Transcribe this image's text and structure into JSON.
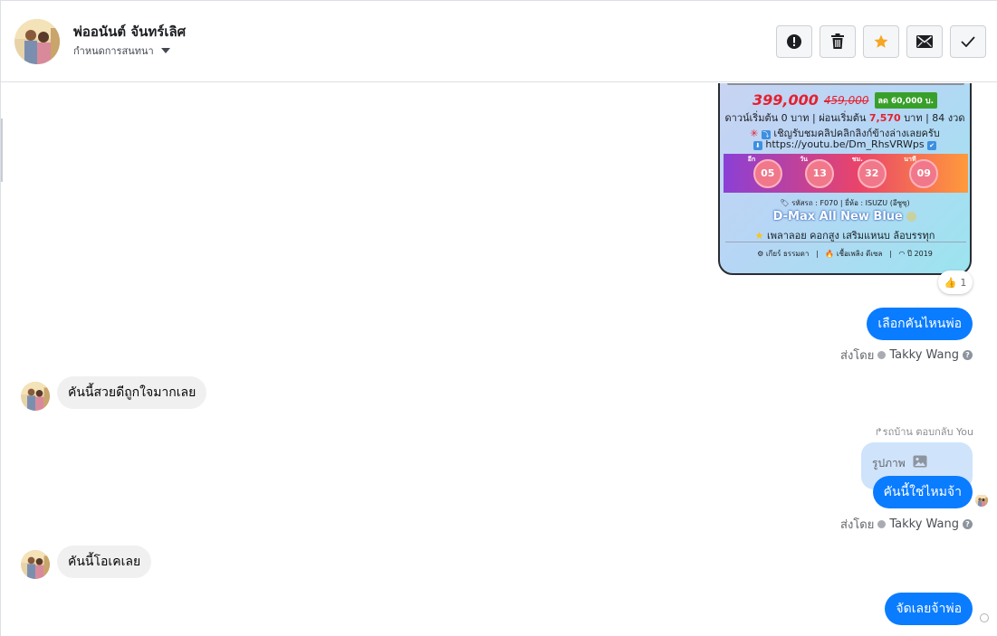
{
  "header": {
    "contact_name": "พ่ออนันต์ จันทร์เลิศ",
    "assign_label": "กำหนดการสนทนา",
    "actions": [
      {
        "name": "report-button",
        "icon": "alert-circle-icon"
      },
      {
        "name": "delete-button",
        "icon": "trash-icon"
      },
      {
        "name": "star-button",
        "icon": "star-icon"
      },
      {
        "name": "mark-unread-button",
        "icon": "envelope-icon"
      },
      {
        "name": "mark-done-button",
        "icon": "check-icon"
      }
    ]
  },
  "card": {
    "price": "399,000",
    "old_price": "459,000",
    "discount_badge": "ลด 60,000 บ.",
    "line_down_prefix": "ดาวน์เริ่มต้น",
    "down_value": "0",
    "line_down_mid": "บาท | ผ่อนเริ่มต้น",
    "installment_value": "7,570",
    "line_down_suffix": "บาท | 84 งวด",
    "clip_text": "เชิญรับชมคลิปคลิกลิงก์ข้างล่างเลยครับ",
    "link": "https://youtu.be/Dm_RhsVRWps",
    "countdown_labels": [
      "อีก",
      "วัน",
      "ชม.",
      "นาที"
    ],
    "countdown_values": [
      "05",
      "13",
      "32",
      "09"
    ],
    "spec_line": "รหัสรถ : F070 | ยี่ห้อ : ISUZU (อีซูซุ)",
    "model": "D-Max All New Blue",
    "features": "เพลาลอย คอกสูง เสริมแหนบ ล้อบรรทุก",
    "gear": "เกียร์ ธรรมดา",
    "fuel": "เชื้อเพลิง ดีเซล",
    "year": "ปี 2019"
  },
  "reaction": {
    "emoji": "👍",
    "count": "1"
  },
  "messages": {
    "m1_out": "เลือกคันไหนพ่อ",
    "sent_by_label": "ส่งโดย",
    "agent_name": "Takky Wang",
    "m2_in": "คันนี้สวยดีถูกใจมากเลย",
    "reply_note": "รถบ้าน ตอบกลับ You",
    "reply_quote": "รูปภาพ",
    "m3_out": "คันนี้ใช่ไหมจ้า",
    "m4_in": "คันนี้โอเคเลย",
    "m5_out": "จัดเลยจ้าพ่อ"
  },
  "colors": {
    "accent": "#0a7cff",
    "incoming_bubble": "#f0f0f0",
    "star": "#f5a623"
  }
}
